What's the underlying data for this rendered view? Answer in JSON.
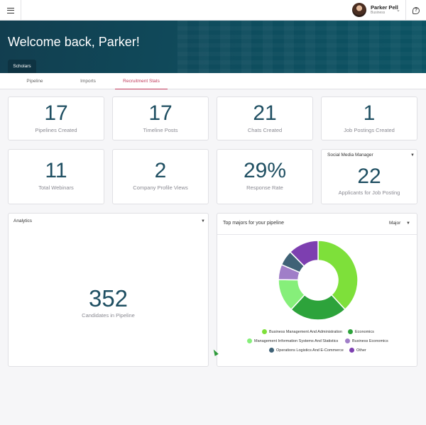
{
  "user": {
    "name": "Parker Pell",
    "role": "Business"
  },
  "hero": {
    "title": "Welcome back, Parker!",
    "tab": "Scholars"
  },
  "subnav": {
    "tabs": [
      "Pipeline",
      "Imports",
      "Recruitment Stats"
    ],
    "active": "Recruitment Stats"
  },
  "stats": {
    "pipelines_created": {
      "value": "17",
      "label": "Pipelines Created"
    },
    "timeline_posts": {
      "value": "17",
      "label": "Timeline Posts"
    },
    "chats_created": {
      "value": "21",
      "label": "Chats Created"
    },
    "job_postings": {
      "value": "1",
      "label": "Job Postings Created"
    },
    "total_webinars": {
      "value": "11",
      "label": "Total Webinars"
    },
    "company_profile_views": {
      "value": "2",
      "label": "Company Profile Views"
    },
    "response_rate": {
      "value": "29%",
      "label": "Response Rate"
    },
    "applicants": {
      "dropdown": "Social Media Manager",
      "value": "22",
      "label": "Applicants for Job Posting"
    }
  },
  "analytics": {
    "dropdown": "Analytics",
    "value": "352",
    "label": "Candidates in Pipeline"
  },
  "majors": {
    "title": "Top majors for your pipeline",
    "dropdown": "Major"
  },
  "colors": {
    "accent": "#c0395a",
    "number": "#1f4f62",
    "hero": "#0f4c5d"
  },
  "chart_data": {
    "type": "pie",
    "title": "Top majors for your pipeline",
    "categories": [
      "Business Management And Administration",
      "Economics",
      "Management Information Systems And Statistics",
      "Business Economics",
      "Operations Logistics And E-Commerce",
      "Other"
    ],
    "values": [
      37,
      23,
      13,
      6,
      6,
      12
    ],
    "colors": [
      "#7ee03a",
      "#2da33b",
      "#86ef7a",
      "#a07ec8",
      "#3f6276",
      "#7d3fb0"
    ],
    "donut": true,
    "legend": "bottom"
  }
}
